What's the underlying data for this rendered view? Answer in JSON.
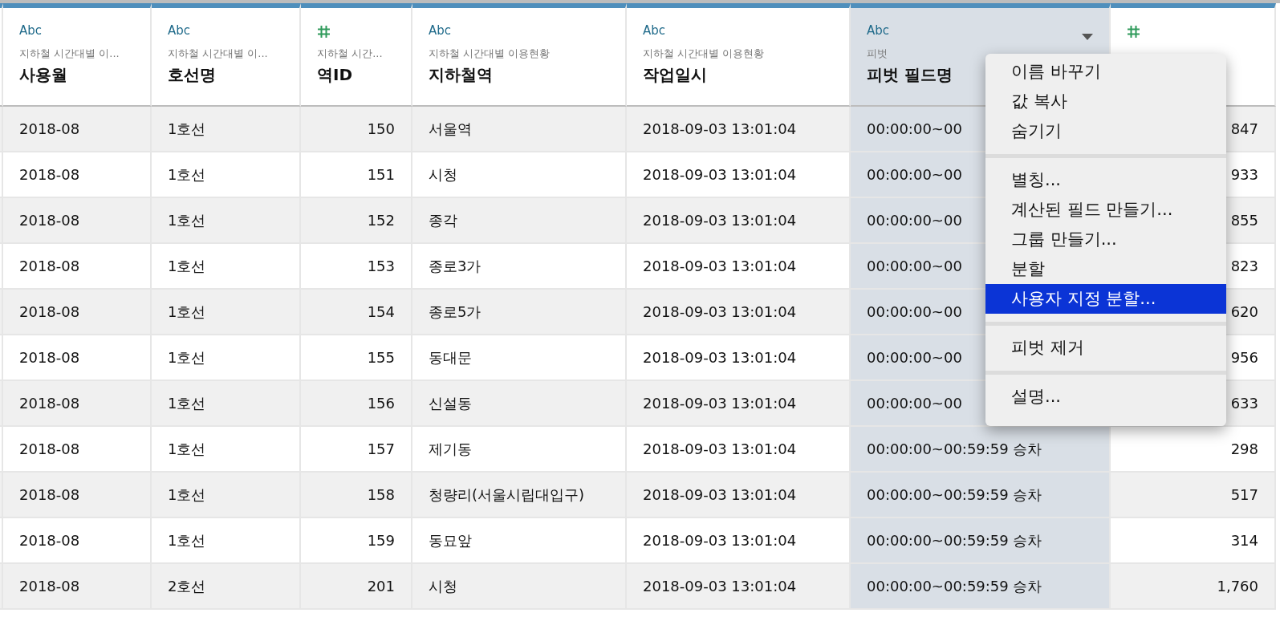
{
  "columns": [
    {
      "kind": "string",
      "type_label": "Abc",
      "source": "지하철 시간대별 이...",
      "name": "사용월",
      "selected": false
    },
    {
      "kind": "string",
      "type_label": "Abc",
      "source": "지하철 시간대별 이...",
      "name": "호선명",
      "selected": false
    },
    {
      "kind": "number",
      "source": "지하철 시간...",
      "name": "역ID",
      "selected": false
    },
    {
      "kind": "string",
      "type_label": "Abc",
      "source": "지하철 시간대별 이용현황",
      "name": "지하철역",
      "selected": false
    },
    {
      "kind": "string",
      "type_label": "Abc",
      "source": "지하철 시간대별 이용현황",
      "name": "작업일시",
      "selected": false
    },
    {
      "kind": "string",
      "type_label": "Abc",
      "source": "피벗",
      "name": "피벗 필드명",
      "selected": true
    },
    {
      "kind": "number",
      "selected": false
    }
  ],
  "rows": [
    [
      "2018-08",
      "1호선",
      "150",
      "서울역",
      "2018-09-03 13:01:04",
      "00:00:00~00",
      "847"
    ],
    [
      "2018-08",
      "1호선",
      "151",
      "시청",
      "2018-09-03 13:01:04",
      "00:00:00~00",
      "933"
    ],
    [
      "2018-08",
      "1호선",
      "152",
      "종각",
      "2018-09-03 13:01:04",
      "00:00:00~00",
      "855"
    ],
    [
      "2018-08",
      "1호선",
      "153",
      "종로3가",
      "2018-09-03 13:01:04",
      "00:00:00~00",
      "823"
    ],
    [
      "2018-08",
      "1호선",
      "154",
      "종로5가",
      "2018-09-03 13:01:04",
      "00:00:00~00",
      "620"
    ],
    [
      "2018-08",
      "1호선",
      "155",
      "동대문",
      "2018-09-03 13:01:04",
      "00:00:00~00",
      "956"
    ],
    [
      "2018-08",
      "1호선",
      "156",
      "신설동",
      "2018-09-03 13:01:04",
      "00:00:00~00",
      "633"
    ],
    [
      "2018-08",
      "1호선",
      "157",
      "제기동",
      "2018-09-03 13:01:04",
      "00:00:00~00:59:59 승차",
      "298"
    ],
    [
      "2018-08",
      "1호선",
      "158",
      "청량리(서울시립대입구)",
      "2018-09-03 13:01:04",
      "00:00:00~00:59:59 승차",
      "517"
    ],
    [
      "2018-08",
      "1호선",
      "159",
      "동묘앞",
      "2018-09-03 13:01:04",
      "00:00:00~00:59:59 승차",
      "314"
    ],
    [
      "2018-08",
      "2호선",
      "201",
      "시청",
      "2018-09-03 13:01:04",
      "00:00:00~00:59:59 승차",
      "1,760"
    ]
  ],
  "menu": {
    "items": [
      {
        "kind": "item",
        "label": "이름 바꾸기",
        "selected": false
      },
      {
        "kind": "item",
        "label": "값 복사",
        "selected": false
      },
      {
        "kind": "item",
        "label": "숨기기",
        "selected": false
      },
      {
        "kind": "separator"
      },
      {
        "kind": "item",
        "label": "별칭...",
        "selected": false
      },
      {
        "kind": "item",
        "label": "계산된 필드 만들기...",
        "selected": false
      },
      {
        "kind": "item",
        "label": "그룹 만들기...",
        "selected": false
      },
      {
        "kind": "item",
        "label": "분할",
        "selected": false
      },
      {
        "kind": "item",
        "label": "사용자 지정 분할...",
        "selected": true
      },
      {
        "kind": "separator"
      },
      {
        "kind": "item",
        "label": "피벗 제거",
        "selected": false
      },
      {
        "kind": "separator"
      },
      {
        "kind": "item",
        "label": "설명...",
        "selected": false
      }
    ]
  }
}
